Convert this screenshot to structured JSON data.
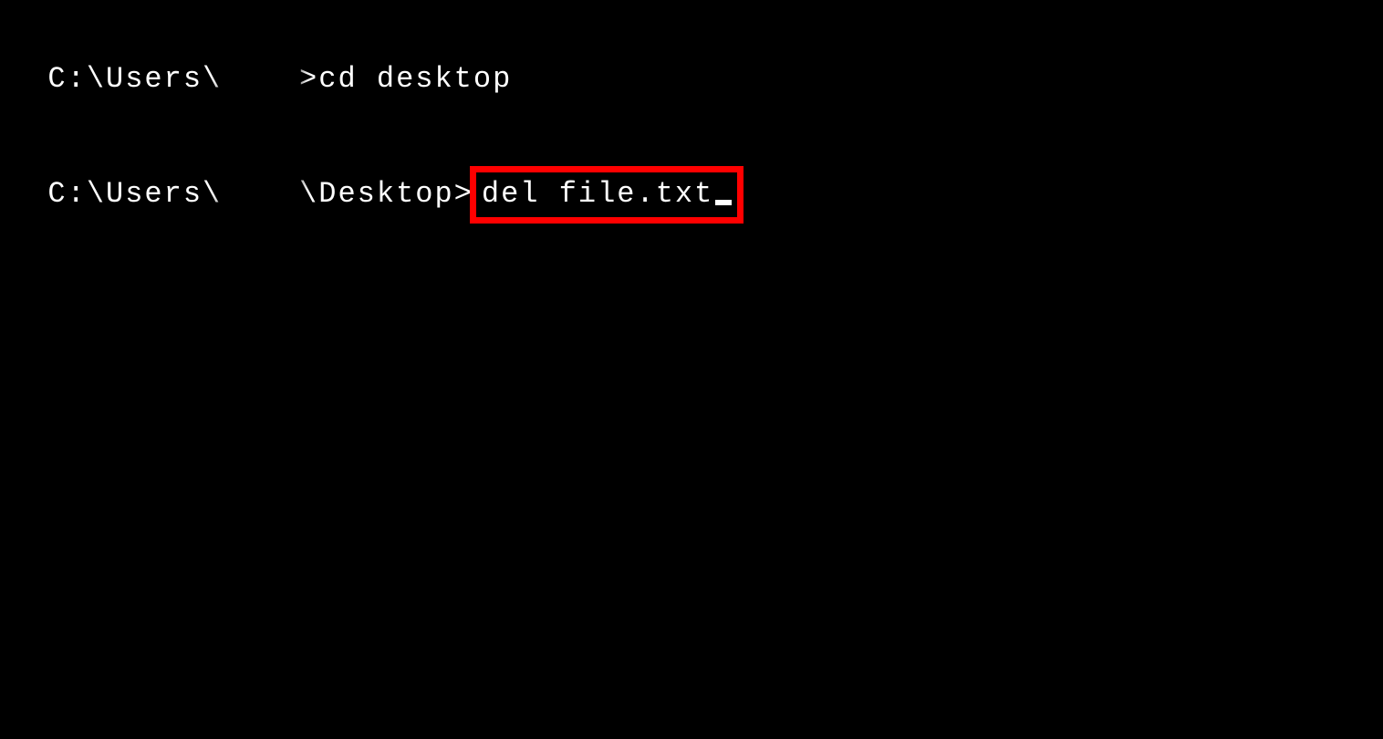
{
  "colors": {
    "background": "#000000",
    "text": "#ffffff",
    "highlight_border": "#ff0000"
  },
  "lines": [
    {
      "prompt_prefix": "C:\\Users\\",
      "redacted_user": "████",
      "prompt_suffix": ">",
      "command": "cd desktop"
    },
    {
      "prompt_prefix": "C:\\Users\\",
      "redacted_user": "████",
      "prompt_suffix": "\\Desktop>",
      "command": "del file.txt",
      "highlighted": true,
      "has_cursor": true
    }
  ]
}
